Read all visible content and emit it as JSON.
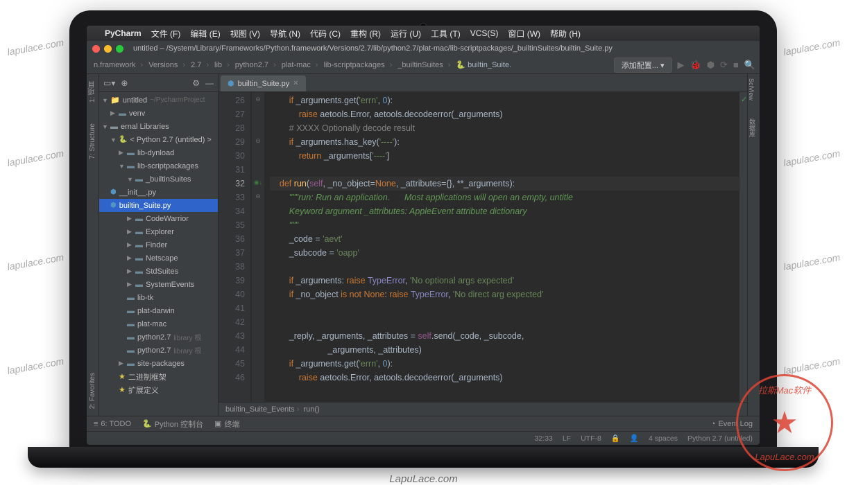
{
  "watermarks": [
    "lapulace.com",
    "lapulace.com",
    "lapulace.com",
    "lapulace.com",
    "lapulace.com",
    "lapulace.com",
    "lapulace.com",
    "lapulace.com"
  ],
  "footer_watermark": "LapuLace.com",
  "stamp": {
    "top": "拉斯Mac软件",
    "bottom": "LapuLace.com"
  },
  "menubar": {
    "apple": "",
    "app": "PyCharm",
    "items": [
      "文件 (F)",
      "编辑 (E)",
      "视图 (V)",
      "导航 (N)",
      "代码 (C)",
      "重构 (R)",
      "运行 (U)",
      "工具 (T)",
      "VCS(S)",
      "窗口 (W)",
      "帮助 (H)"
    ]
  },
  "window_title": "untitled – /System/Library/Frameworks/Python.framework/Versions/2.7/lib/python2.7/plat-mac/lib-scriptpackages/_builtinSuites/builtin_Suite.py",
  "breadcrumbs": [
    "n.framework",
    "Versions",
    "2.7",
    "lib",
    "python2.7",
    "plat-mac",
    "lib-scriptpackages",
    "_builtinSuites",
    "builtin_Suite."
  ],
  "config_label": "添加配置...",
  "left_tabs": [
    "1: 项目",
    "7: Structure",
    "2: Favorites"
  ],
  "right_tab": "SciView",
  "right_tab2": "数据库",
  "project_tree": [
    {
      "d": 0,
      "ic": "fold",
      "exp": "▼",
      "label": "untitled",
      "suffix": "~/PycharmProject"
    },
    {
      "d": 1,
      "ic": "pkg",
      "exp": "▶",
      "label": "venv"
    },
    {
      "d": 0,
      "ic": "lib",
      "exp": "▼",
      "label": "ernal Libraries"
    },
    {
      "d": 1,
      "ic": "py",
      "exp": "▼",
      "label": "< Python 2.7 (untitled) >"
    },
    {
      "d": 2,
      "ic": "pkg",
      "exp": "▶",
      "label": "lib-dynload"
    },
    {
      "d": 2,
      "ic": "pkg",
      "exp": "▼",
      "label": "lib-scriptpackages"
    },
    {
      "d": 3,
      "ic": "pkg",
      "exp": "▼",
      "label": "_builtinSuites"
    },
    {
      "d": 3,
      "ic": "pyf",
      "exp": "",
      "label": "__init__.py",
      "ind": 4
    },
    {
      "d": 3,
      "ic": "pyf",
      "exp": "",
      "label": "builtin_Suite.py",
      "sel": true,
      "ind": 4
    },
    {
      "d": 3,
      "ic": "pkg",
      "exp": "▶",
      "label": "CodeWarrior"
    },
    {
      "d": 3,
      "ic": "pkg",
      "exp": "▶",
      "label": "Explorer"
    },
    {
      "d": 3,
      "ic": "pkg",
      "exp": "▶",
      "label": "Finder"
    },
    {
      "d": 3,
      "ic": "pkg",
      "exp": "▶",
      "label": "Netscape"
    },
    {
      "d": 3,
      "ic": "pkg",
      "exp": "▶",
      "label": "StdSuites"
    },
    {
      "d": 3,
      "ic": "pkg",
      "exp": "▶",
      "label": "SystemEvents"
    },
    {
      "d": 2,
      "ic": "pkg",
      "exp": "",
      "label": "lib-tk"
    },
    {
      "d": 2,
      "ic": "pkg",
      "exp": "",
      "label": "plat-darwin"
    },
    {
      "d": 2,
      "ic": "pkg",
      "exp": "",
      "label": "plat-mac"
    },
    {
      "d": 2,
      "ic": "pkg",
      "exp": "",
      "label": "python2.7",
      "suffix": "library 根"
    },
    {
      "d": 2,
      "ic": "pkg",
      "exp": "",
      "label": "python2.7",
      "suffix": "library 根"
    },
    {
      "d": 2,
      "ic": "pkg",
      "exp": "▶",
      "label": "site-packages"
    },
    {
      "d": 1,
      "ic": "star",
      "exp": "",
      "label": "二进制框架"
    },
    {
      "d": 1,
      "ic": "star",
      "exp": "",
      "label": "扩展定义"
    }
  ],
  "tab_label": "builtin_Suite.py",
  "gutter_lines": [
    "26",
    "27",
    "28",
    "29",
    "30",
    "31",
    "32",
    "33",
    "34",
    "35",
    "36",
    "37",
    "38",
    "39",
    "40",
    "41",
    "42",
    "43",
    "44",
    "45",
    "46"
  ],
  "highlighted_line": "32",
  "code_crumbs": [
    "builtin_Suite_Events",
    "run()"
  ],
  "bottom_bar": {
    "todo": "6: TODO",
    "console": "Python 控制台",
    "terminal": "终端",
    "eventlog": "Event Log"
  },
  "status": {
    "pos": "32:33",
    "le": "LF",
    "enc": "UTF-8",
    "lock": "🔒",
    "spaces": "4 spaces",
    "interp": "Python 2.7 (untitled)"
  }
}
